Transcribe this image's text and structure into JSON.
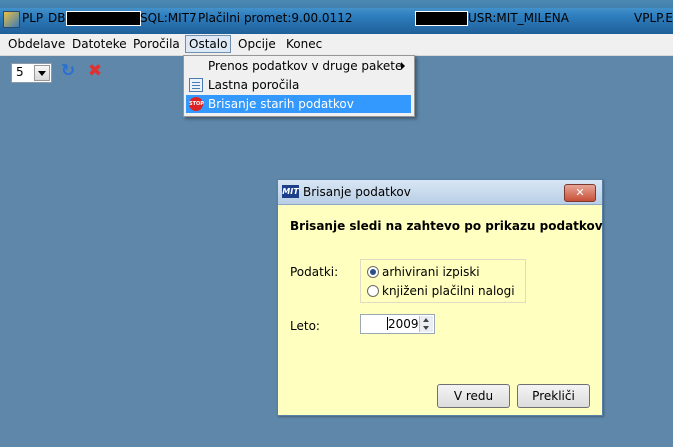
{
  "titlebar": {
    "app": "PLP",
    "db_label": "DB:",
    "sql": "SQL:MIT7",
    "app_name": "Plačilni promet:9.00.0112",
    "user": "USR:MIT_MILENA",
    "right_text": "VPLP.EX"
  },
  "menubar": {
    "items": [
      "Obdelave",
      "Datoteke",
      "Poročila",
      "Ostalo",
      "Opcije",
      "Konec"
    ],
    "active": "Ostalo"
  },
  "toolbar": {
    "combo_value": "5",
    "icons": [
      "refresh-icon",
      "delete-icon"
    ]
  },
  "dropdown": {
    "items": [
      {
        "label": "Prenos podatkov v druge pakete",
        "submenu": true
      },
      {
        "label": "Lastna poročila",
        "icon": "list-icon"
      },
      {
        "label": "Brisanje starih podatkov",
        "icon": "stop-icon",
        "selected": true
      }
    ]
  },
  "dialog": {
    "title": "Brisanje podatkov",
    "logo": "MIT",
    "heading": "Brisanje sledi na zahtevo po prikazu podatkov",
    "data_label": "Podatki:",
    "options": [
      "arhivirani izpiski",
      "knjiženi plačilni nalogi"
    ],
    "selected_option": "arhivirani izpiski",
    "year_label": "Leto:",
    "year_value": "2009",
    "ok_label": "V redu",
    "cancel_label": "Prekliči",
    "close_glyph": "✕"
  },
  "colors": {
    "desktop": "#5f87a9",
    "dialog_bg": "#ffffc0",
    "menu_highlight": "#3399ff"
  }
}
